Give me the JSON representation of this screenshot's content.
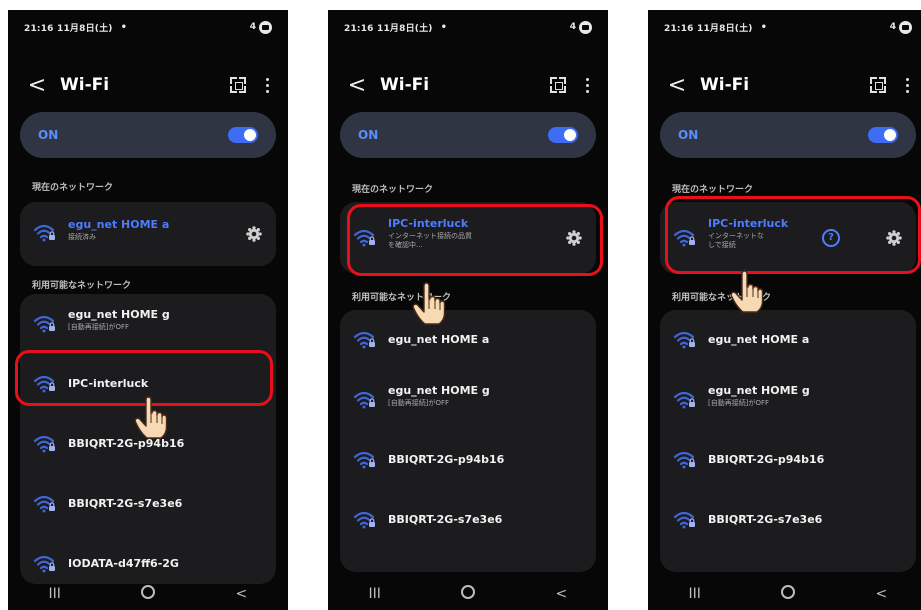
{
  "status_bar": {
    "time": "21:16 11月8日(土)",
    "dot": "•",
    "signal": "4"
  },
  "header": {
    "back": "<",
    "title": "Wi-Fi"
  },
  "toggle": {
    "label": "ON"
  },
  "sections": {
    "current": "現在のネットワーク",
    "available": "利用可能なネットワーク"
  },
  "nav": {
    "recents": "III",
    "back": "<"
  },
  "colors": {
    "accent": "#4d7cff",
    "toggle_bg": "#2f3543",
    "card_bg": "#1c1c1e",
    "highlight": "#e8101a"
  },
  "screens": [
    {
      "current": {
        "ssid": "egu_net HOME a",
        "status": "接続済み"
      },
      "available": [
        {
          "ssid": "egu_net HOME g",
          "sub": "[自動再接続]がOFF"
        },
        {
          "ssid": "IPC-interluck",
          "sub": ""
        },
        {
          "ssid": "BBIQRT-2G-p94b16",
          "sub": ""
        },
        {
          "ssid": "BBIQRT-2G-s7e3e6",
          "sub": ""
        },
        {
          "ssid": "IODATA-d47ff6-2G",
          "sub": ""
        }
      ]
    },
    {
      "current": {
        "ssid": "IPC-interluck",
        "status_line1": "インターネット接続の品質",
        "status_line2": "を確認中..."
      },
      "available": [
        {
          "ssid": "egu_net HOME a",
          "sub": ""
        },
        {
          "ssid": "egu_net HOME g",
          "sub": "[自動再接続]がOFF"
        },
        {
          "ssid": "BBIQRT-2G-p94b16",
          "sub": ""
        },
        {
          "ssid": "BBIQRT-2G-s7e3e6",
          "sub": ""
        }
      ]
    },
    {
      "current": {
        "ssid": "IPC-interluck",
        "status_line1": "インターネットな",
        "status_line2": "しで接続",
        "info_icon": "?"
      },
      "available": [
        {
          "ssid": "egu_net HOME a",
          "sub": ""
        },
        {
          "ssid": "egu_net HOME g",
          "sub": "[自動再接続]がOFF"
        },
        {
          "ssid": "BBIQRT-2G-p94b16",
          "sub": ""
        },
        {
          "ssid": "BBIQRT-2G-s7e3e6",
          "sub": ""
        }
      ]
    }
  ]
}
